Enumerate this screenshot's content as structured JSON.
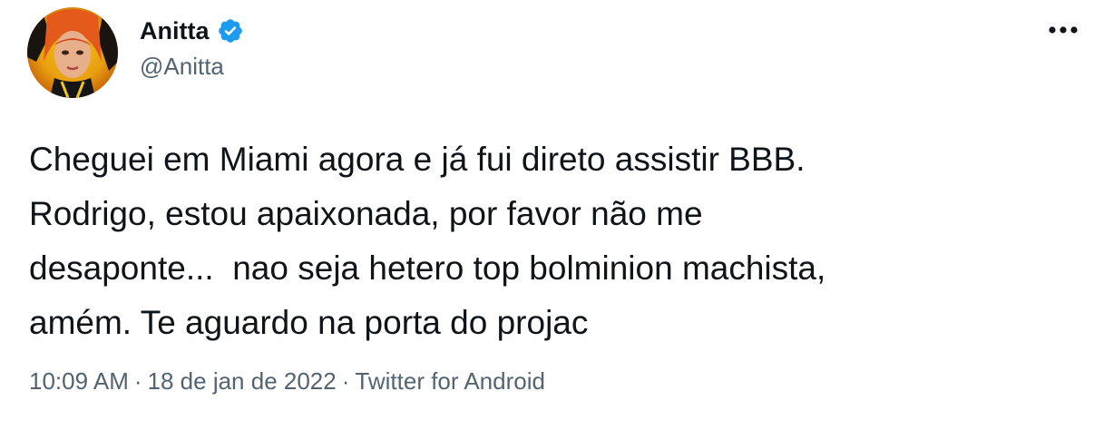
{
  "author": {
    "display_name": "Anitta",
    "handle": "@Anitta",
    "verified": true
  },
  "menu": {
    "more_label": "···"
  },
  "tweet": {
    "text_lines": [
      "Cheguei em Miami agora e já fui direto assistir BBB.",
      "Rodrigo, estou apaixonada, por favor não me",
      "desaponte...  nao seja hetero top bolminion machista,",
      "amém. Te aguardo na porta do projac"
    ]
  },
  "meta": {
    "time": "10:09 AM",
    "date": "18 de jan de 2022",
    "source": "Twitter for Android",
    "separator": "·"
  },
  "colors": {
    "verified_badge": "#1d9bf0",
    "secondary_text": "#536471",
    "primary_text": "#0f1419"
  },
  "icons": {
    "verified": "verified-badge-icon",
    "more": "more-options-icon",
    "avatar": "profile-photo"
  }
}
